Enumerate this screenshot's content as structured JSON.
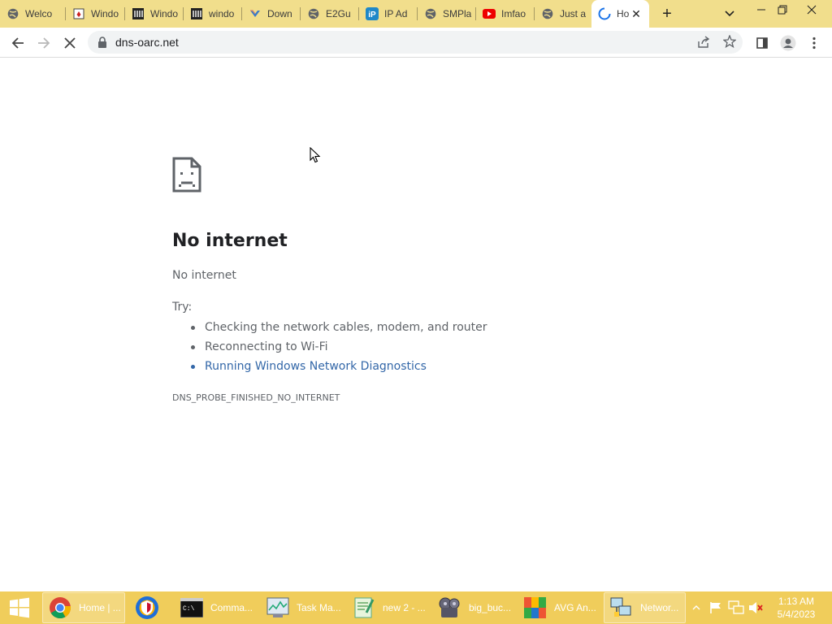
{
  "browser": {
    "tabs": [
      {
        "label": "Welco",
        "icon": "globe-icon"
      },
      {
        "label": "Windo",
        "icon": "cards-icon"
      },
      {
        "label": "Windo",
        "icon": "archive-icon"
      },
      {
        "label": "windo",
        "icon": "archive-icon"
      },
      {
        "label": "Down",
        "icon": "download-site-icon"
      },
      {
        "label": "E2Gu",
        "icon": "globe-icon"
      },
      {
        "label": "IP Ad",
        "icon": "ip-icon"
      },
      {
        "label": "SMPla",
        "icon": "globe-icon"
      },
      {
        "label": "Imfao",
        "icon": "youtube-icon"
      },
      {
        "label": "Just a",
        "icon": "globe-icon"
      },
      {
        "label": "Ho",
        "icon": "loading-icon"
      }
    ],
    "url": "dns-oarc.net"
  },
  "error_page": {
    "title": "No internet",
    "subtitle": "No internet",
    "try_label": "Try:",
    "suggestions": [
      "Checking the network cables, modem, and router",
      "Reconnecting to Wi-Fi",
      "Running Windows Network Diagnostics"
    ],
    "error_code": "DNS_PROBE_FINISHED_NO_INTERNET"
  },
  "taskbar": {
    "items": [
      {
        "label": "Home | ...",
        "icon": "chrome-icon"
      },
      {
        "label": "",
        "icon": "browser-shield-icon"
      },
      {
        "label": "Comma...",
        "icon": "cmd-icon"
      },
      {
        "label": "Task Ma...",
        "icon": "task-manager-icon"
      },
      {
        "label": "new 2 - ...",
        "icon": "notepad-plus-icon"
      },
      {
        "label": "big_buc...",
        "icon": "media-player-icon"
      },
      {
        "label": "AVG An...",
        "icon": "avg-icon"
      },
      {
        "label": "Networ...",
        "icon": "network-icon"
      }
    ],
    "time": "1:13 AM",
    "date": "5/4/2023"
  },
  "colors": {
    "tabstrip": "#f1de8c",
    "taskbar": "#f0cd5b",
    "link": "#3367a8"
  }
}
